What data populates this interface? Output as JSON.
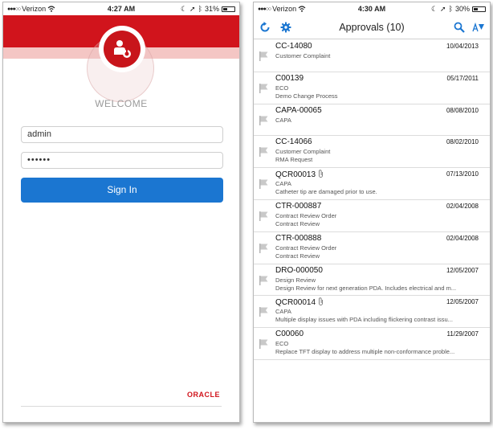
{
  "login_screen": {
    "status_bar": {
      "carrier": "Verizon",
      "time": "4:27 AM",
      "battery": "31%"
    },
    "welcome": "WELCOME",
    "username_value": "admin",
    "password_value": "••••••",
    "sign_in_label": "Sign In",
    "brand": "ORACLE"
  },
  "approvals_screen": {
    "status_bar": {
      "carrier": "Verizon",
      "time": "4:30 AM",
      "battery": "30%"
    },
    "title": "Approvals (10)",
    "items": [
      {
        "id": "CC-14080",
        "date": "10/04/2013",
        "line1": "Customer Complaint",
        "line2": "",
        "attachment": false
      },
      {
        "id": "C00139",
        "date": "05/17/2011",
        "line1": "ECO",
        "line2": "Demo Change Process",
        "attachment": false
      },
      {
        "id": "CAPA-00065",
        "date": "08/08/2010",
        "line1": "CAPA",
        "line2": "",
        "attachment": false
      },
      {
        "id": "CC-14066",
        "date": "08/02/2010",
        "line1": "Customer Complaint",
        "line2": "RMA Request",
        "attachment": false
      },
      {
        "id": "QCR00013",
        "date": "07/13/2010",
        "line1": "CAPA",
        "line2": "Catheter tip are damaged prior to use.",
        "attachment": true
      },
      {
        "id": "CTR-000887",
        "date": "02/04/2008",
        "line1": "Contract Review Order",
        "line2": "Contract Review",
        "attachment": false
      },
      {
        "id": "CTR-000888",
        "date": "02/04/2008",
        "line1": "Contract Review Order",
        "line2": "Contract Review",
        "attachment": false
      },
      {
        "id": "DRO-000050",
        "date": "12/05/2007",
        "line1": "Design Review",
        "line2": "Design Review for next generation PDA. Includes electrical and m...",
        "attachment": false
      },
      {
        "id": "QCR00014",
        "date": "12/05/2007",
        "line1": "CAPA",
        "line2": "Multiple display issues with PDA including flickering contrast issu...",
        "attachment": true
      },
      {
        "id": "C00060",
        "date": "11/29/2007",
        "line1": "ECO",
        "line2": "Replace TFT display to address multiple non-conformance proble...",
        "attachment": false
      }
    ]
  },
  "colors": {
    "oracle_red": "#d1141c",
    "button_blue": "#1b76d1",
    "icon_blue": "#1b76d1"
  },
  "icons": [
    "wifi-icon",
    "location-icon",
    "bluetooth-icon",
    "moon-icon",
    "battery-icon",
    "user-badge-icon",
    "refresh-icon",
    "gear-icon",
    "search-icon",
    "sort-icon",
    "flag-icon",
    "paperclip-icon"
  ]
}
